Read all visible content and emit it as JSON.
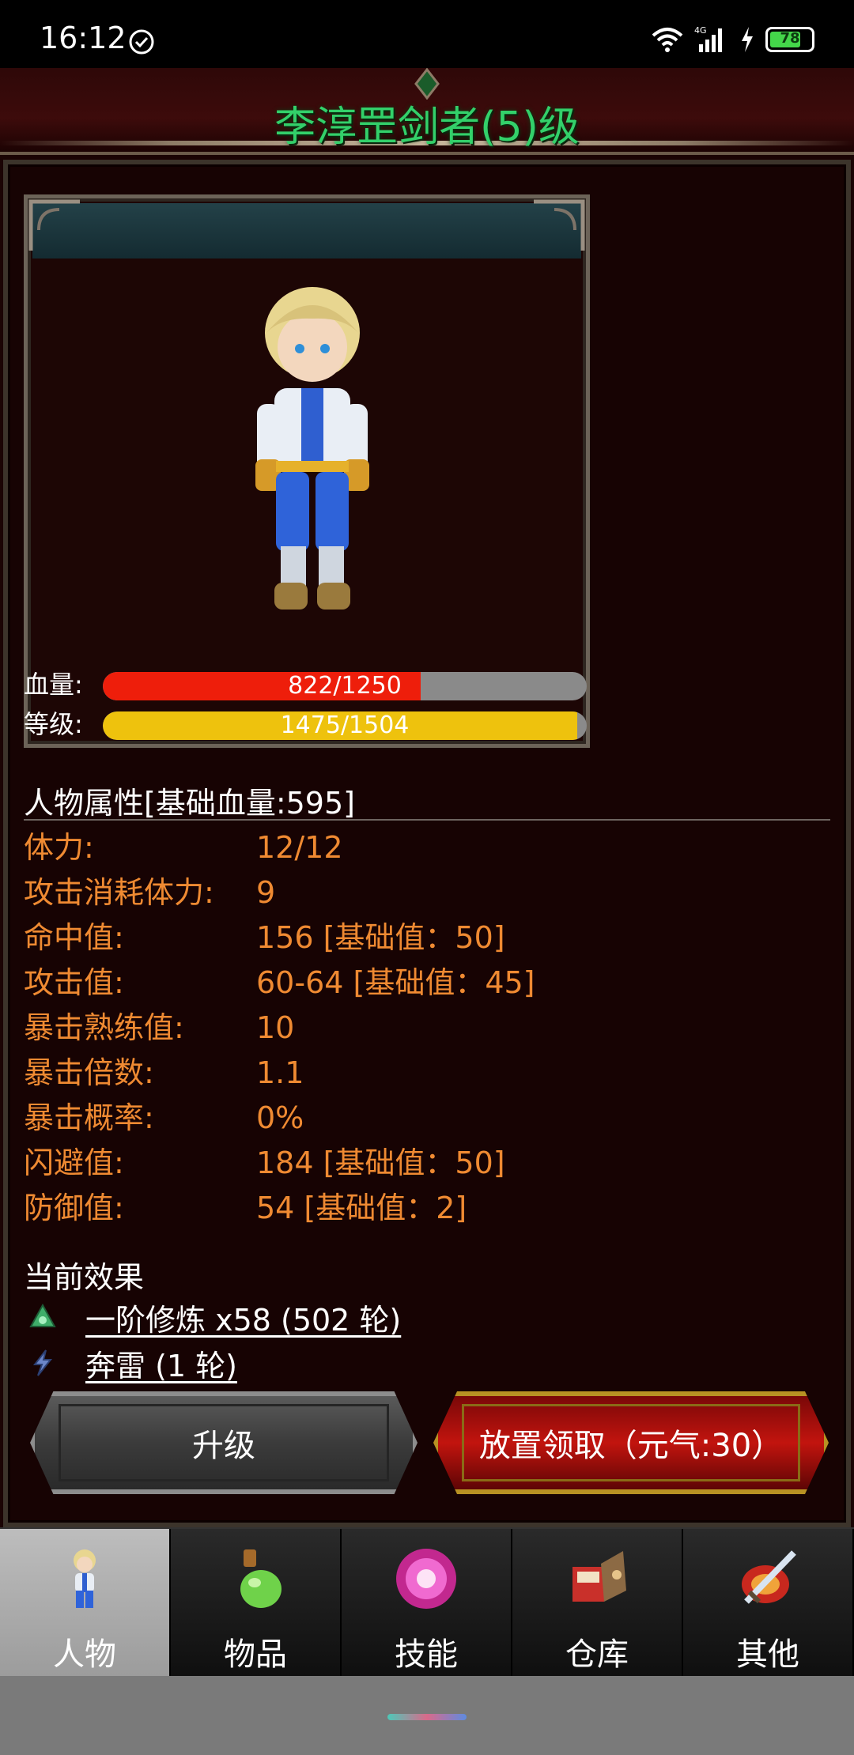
{
  "status_bar": {
    "time": "16:12",
    "network": "4G",
    "battery": "78",
    "battery_level": 0.78
  },
  "character": {
    "title": "李淳罡剑者(5)级"
  },
  "bars": {
    "hp": {
      "label": "血量:",
      "text": "822/1250",
      "current": 822,
      "max": 1250,
      "color": "#ee1e0b"
    },
    "level": {
      "label": "等级:",
      "text": "1475/1504",
      "current": 1475,
      "max": 1504,
      "color": "#eec20d"
    }
  },
  "attributes": {
    "header": "人物属性[基础血量:595]",
    "rows": [
      {
        "label": "体力:",
        "value": "12/12"
      },
      {
        "label": "攻击消耗体力:",
        "value": "9"
      },
      {
        "label": "命中值:",
        "value": "156 [基础值：50]"
      },
      {
        "label": "攻击值:",
        "value": "60-64 [基础值：45]"
      },
      {
        "label": "暴击熟练值:",
        "value": "10"
      },
      {
        "label": "暴击倍数:",
        "value": "1.1"
      },
      {
        "label": "暴击概率:",
        "value": "0%"
      },
      {
        "label": "闪避值:",
        "value": "184 [基础值：50]"
      },
      {
        "label": "防御值:",
        "value": "54 [基础值：2]"
      }
    ]
  },
  "effects": {
    "title": "当前效果",
    "items": [
      {
        "text": "一阶修炼 x58 (502 轮)",
        "icon": "cultivation-icon"
      },
      {
        "text": "奔雷 (1 轮)",
        "icon": "thunder-icon"
      }
    ]
  },
  "actions": {
    "upgrade": "升级",
    "idle_claim": "放置领取（元气:30）"
  },
  "nav": {
    "tabs": [
      {
        "label": "人物",
        "icon": "character-icon",
        "active": true
      },
      {
        "label": "物品",
        "icon": "potion-icon",
        "active": false
      },
      {
        "label": "技能",
        "icon": "skill-orb-icon",
        "active": false
      },
      {
        "label": "仓库",
        "icon": "warehouse-icon",
        "active": false
      },
      {
        "label": "其他",
        "icon": "sword-shield-icon",
        "active": false
      }
    ]
  },
  "colors": {
    "title_green": "#33d06a",
    "attribute_orange": "#ef8a32",
    "hp_red": "#ee1e0b",
    "xp_yellow": "#eec20d"
  }
}
